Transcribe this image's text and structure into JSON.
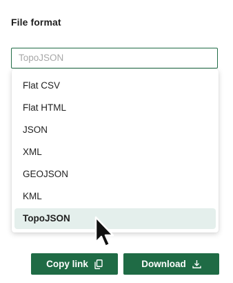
{
  "field": {
    "label": "File format",
    "placeholder": "TopoJSON"
  },
  "dropdown": {
    "options": [
      {
        "label": "Flat CSV"
      },
      {
        "label": "Flat HTML"
      },
      {
        "label": "JSON"
      },
      {
        "label": "XML"
      },
      {
        "label": "GEOJSON"
      },
      {
        "label": "KML"
      },
      {
        "label": "TopoJSON"
      }
    ],
    "selected": "TopoJSON"
  },
  "actions": {
    "copy_link_label": "Copy link",
    "copy_link_icon": "copy-icon",
    "download_label": "Download",
    "download_icon": "download-icon"
  },
  "colors": {
    "accent": "#1f6b45",
    "selected_bg": "#e4efec",
    "placeholder": "#a8a8a8"
  }
}
